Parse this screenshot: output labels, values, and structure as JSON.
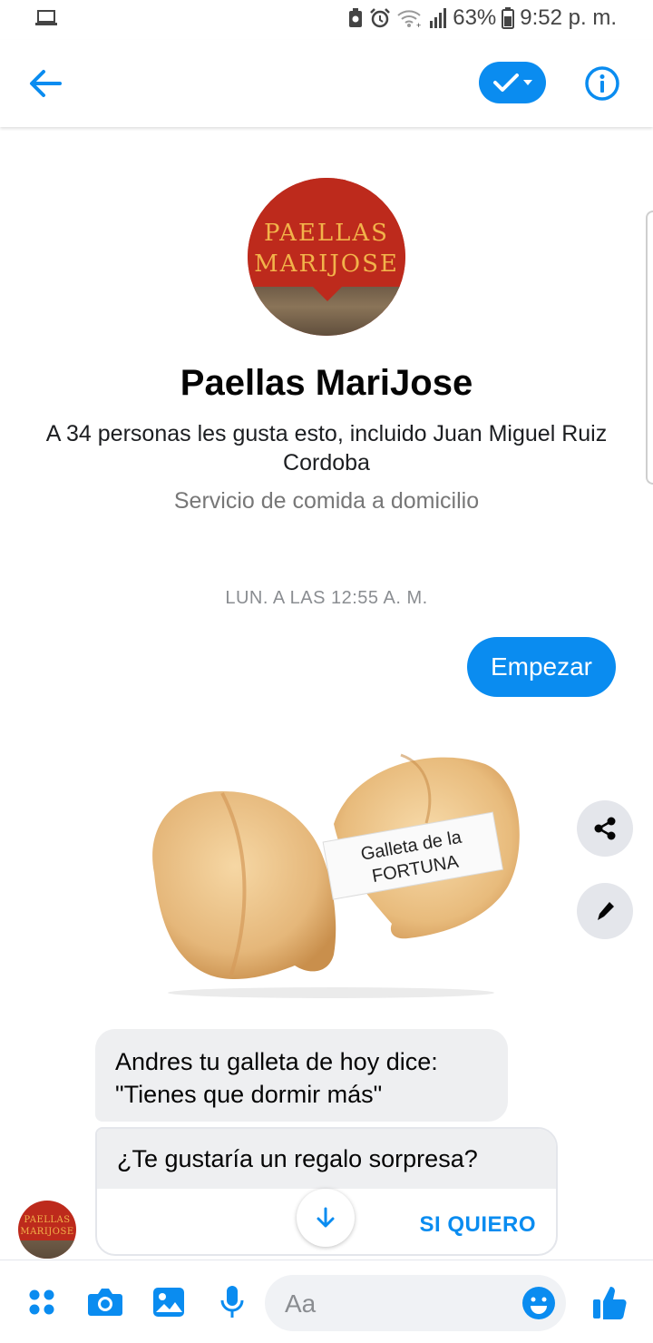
{
  "status_bar": {
    "battery": "63%",
    "time": "9:52 p. m.",
    "icons": [
      "laptop-icon",
      "battery-saver-icon",
      "alarm-icon",
      "wifi-icon",
      "signal-icon",
      "battery-icon"
    ]
  },
  "header": {
    "back_icon": "back-arrow-icon",
    "check_icon": "checkmark-dropdown-icon",
    "info_icon": "info-icon"
  },
  "profile": {
    "logo_line1": "PAELLAS",
    "logo_line2": "MARIJOSE",
    "name": "Paellas MariJose",
    "likes": "A 34 personas les gusta esto, incluido Juan Miguel Ruiz Cordoba",
    "category": "Servicio de comida a domicilio"
  },
  "conversation": {
    "timestamp": "LUN. A LAS 12:55 A. M.",
    "outgoing_message": "Empezar",
    "image_caption_line1": "Galleta de la",
    "image_caption_line2": "FORTUNA",
    "incoming_line1": "Andres tu galleta de hoy dice:",
    "incoming_line2": "\"Tienes que dormir más\"",
    "quick_reply_question": "¿Te gustaría un regalo sorpresa?",
    "quick_reply_answer": "SI QUIERO",
    "sender_avatar_line1": "PAELLAS",
    "sender_avatar_line2": "MARIJOSE"
  },
  "composer": {
    "placeholder": "Aa",
    "icons": [
      "apps-icon",
      "camera-icon",
      "gallery-icon",
      "microphone-icon",
      "emoji-icon",
      "thumbs-up-icon"
    ]
  },
  "colors": {
    "accent": "#0a8cf0",
    "bubble_in": "#eeeff1",
    "brand_red": "#bd2a1c",
    "brand_gold": "#f2b34a"
  }
}
